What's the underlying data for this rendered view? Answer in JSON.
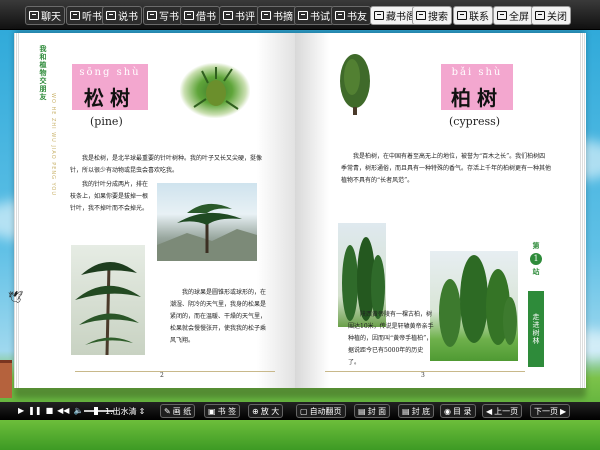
{
  "toolbar": {
    "left_buttons": [
      {
        "label": "聊天",
        "icon": "chat-icon"
      },
      {
        "label": "听书",
        "icon": "headphone-icon"
      },
      {
        "label": "说书",
        "icon": "speak-icon"
      },
      {
        "label": "写书",
        "icon": "pen-icon"
      },
      {
        "label": "借书",
        "icon": "book-icon"
      },
      {
        "label": "书评",
        "icon": "comment-icon"
      },
      {
        "label": "书摘",
        "icon": "excerpt-icon"
      },
      {
        "label": "书试",
        "icon": "test-icon"
      },
      {
        "label": "书友",
        "icon": "friends-icon"
      }
    ],
    "right_buttons": [
      {
        "label": "藏书阁",
        "icon": "library-icon"
      },
      {
        "label": "搜索",
        "icon": "search-icon"
      },
      {
        "label": "联系",
        "icon": "mail-icon"
      },
      {
        "label": "全屏",
        "icon": "fullscreen-icon"
      },
      {
        "label": "关闭",
        "icon": "close-icon"
      }
    ]
  },
  "left_page": {
    "side_title": "我和植物交朋友",
    "side_pinyin": "WO HE ZHI WU JIAO PENG YOU",
    "pinyin": "sōng shù",
    "hanzi": "松树",
    "english": "(pine)",
    "para1": "我是松树，是北半球最重要的针叶树种。我的叶子又长又尖硬，挺像针，所以很少有动物或昆虫会喜欢吃我。",
    "para2": "我的针叶分成两片，排在枝条上，如果你要是拔掉一根针叶，我不掉叶而不会掉光。",
    "para3": "我的球果是圆锥形或球形的，在潮湿、阴冷的天气里，我身的松果是紧闭的，而在温暖、干燥的天气里，松果就会慢慢张开，使我我的松子乘风飞翔。",
    "page_no": "2"
  },
  "right_page": {
    "pinyin": "bǎi shù",
    "hanzi": "柏树",
    "english": "(cypress)",
    "para1": "我是柏树，在中国有着至高无上的地位，被誉为“百木之长”。我们柏树四季常青，树形通俗，而且具有一种特殊的香气。存活上千年的柏树更有一种其他植物不具有的“长者风范”。",
    "para2": "陕西黄帝陵有一棵古柏，树围达10米，传说是轩辕黄帝亲手种植的，因而叫“黄帝手植柏”，据说距今已有5000年的历史了。",
    "chapter_label": "第",
    "chapter_number": "1",
    "chapter_suffix": "站",
    "chapter_title": "走进树林",
    "page_no": "3"
  },
  "bottombar": {
    "speed_label": "1.出水清",
    "buttons": [
      {
        "label": "画 纸",
        "icon": "pencil-icon"
      },
      {
        "label": "书 签",
        "icon": "bookmark-icon"
      },
      {
        "label": "放 大",
        "icon": "zoom-icon"
      },
      {
        "label": "自动翻页",
        "icon": "auto-page-icon"
      },
      {
        "label": "封 面",
        "icon": "cover-icon"
      },
      {
        "label": "封 底",
        "icon": "back-cover-icon"
      },
      {
        "label": "目 录",
        "icon": "contents-icon"
      },
      {
        "label": "上一页",
        "icon": "prev-icon"
      },
      {
        "label": "下一页",
        "icon": "next-icon"
      }
    ]
  },
  "colors": {
    "title_pink": "#f3a7cf",
    "chapter_green": "#2e8b3a",
    "toolbar_bg": "#1a1a1a"
  }
}
